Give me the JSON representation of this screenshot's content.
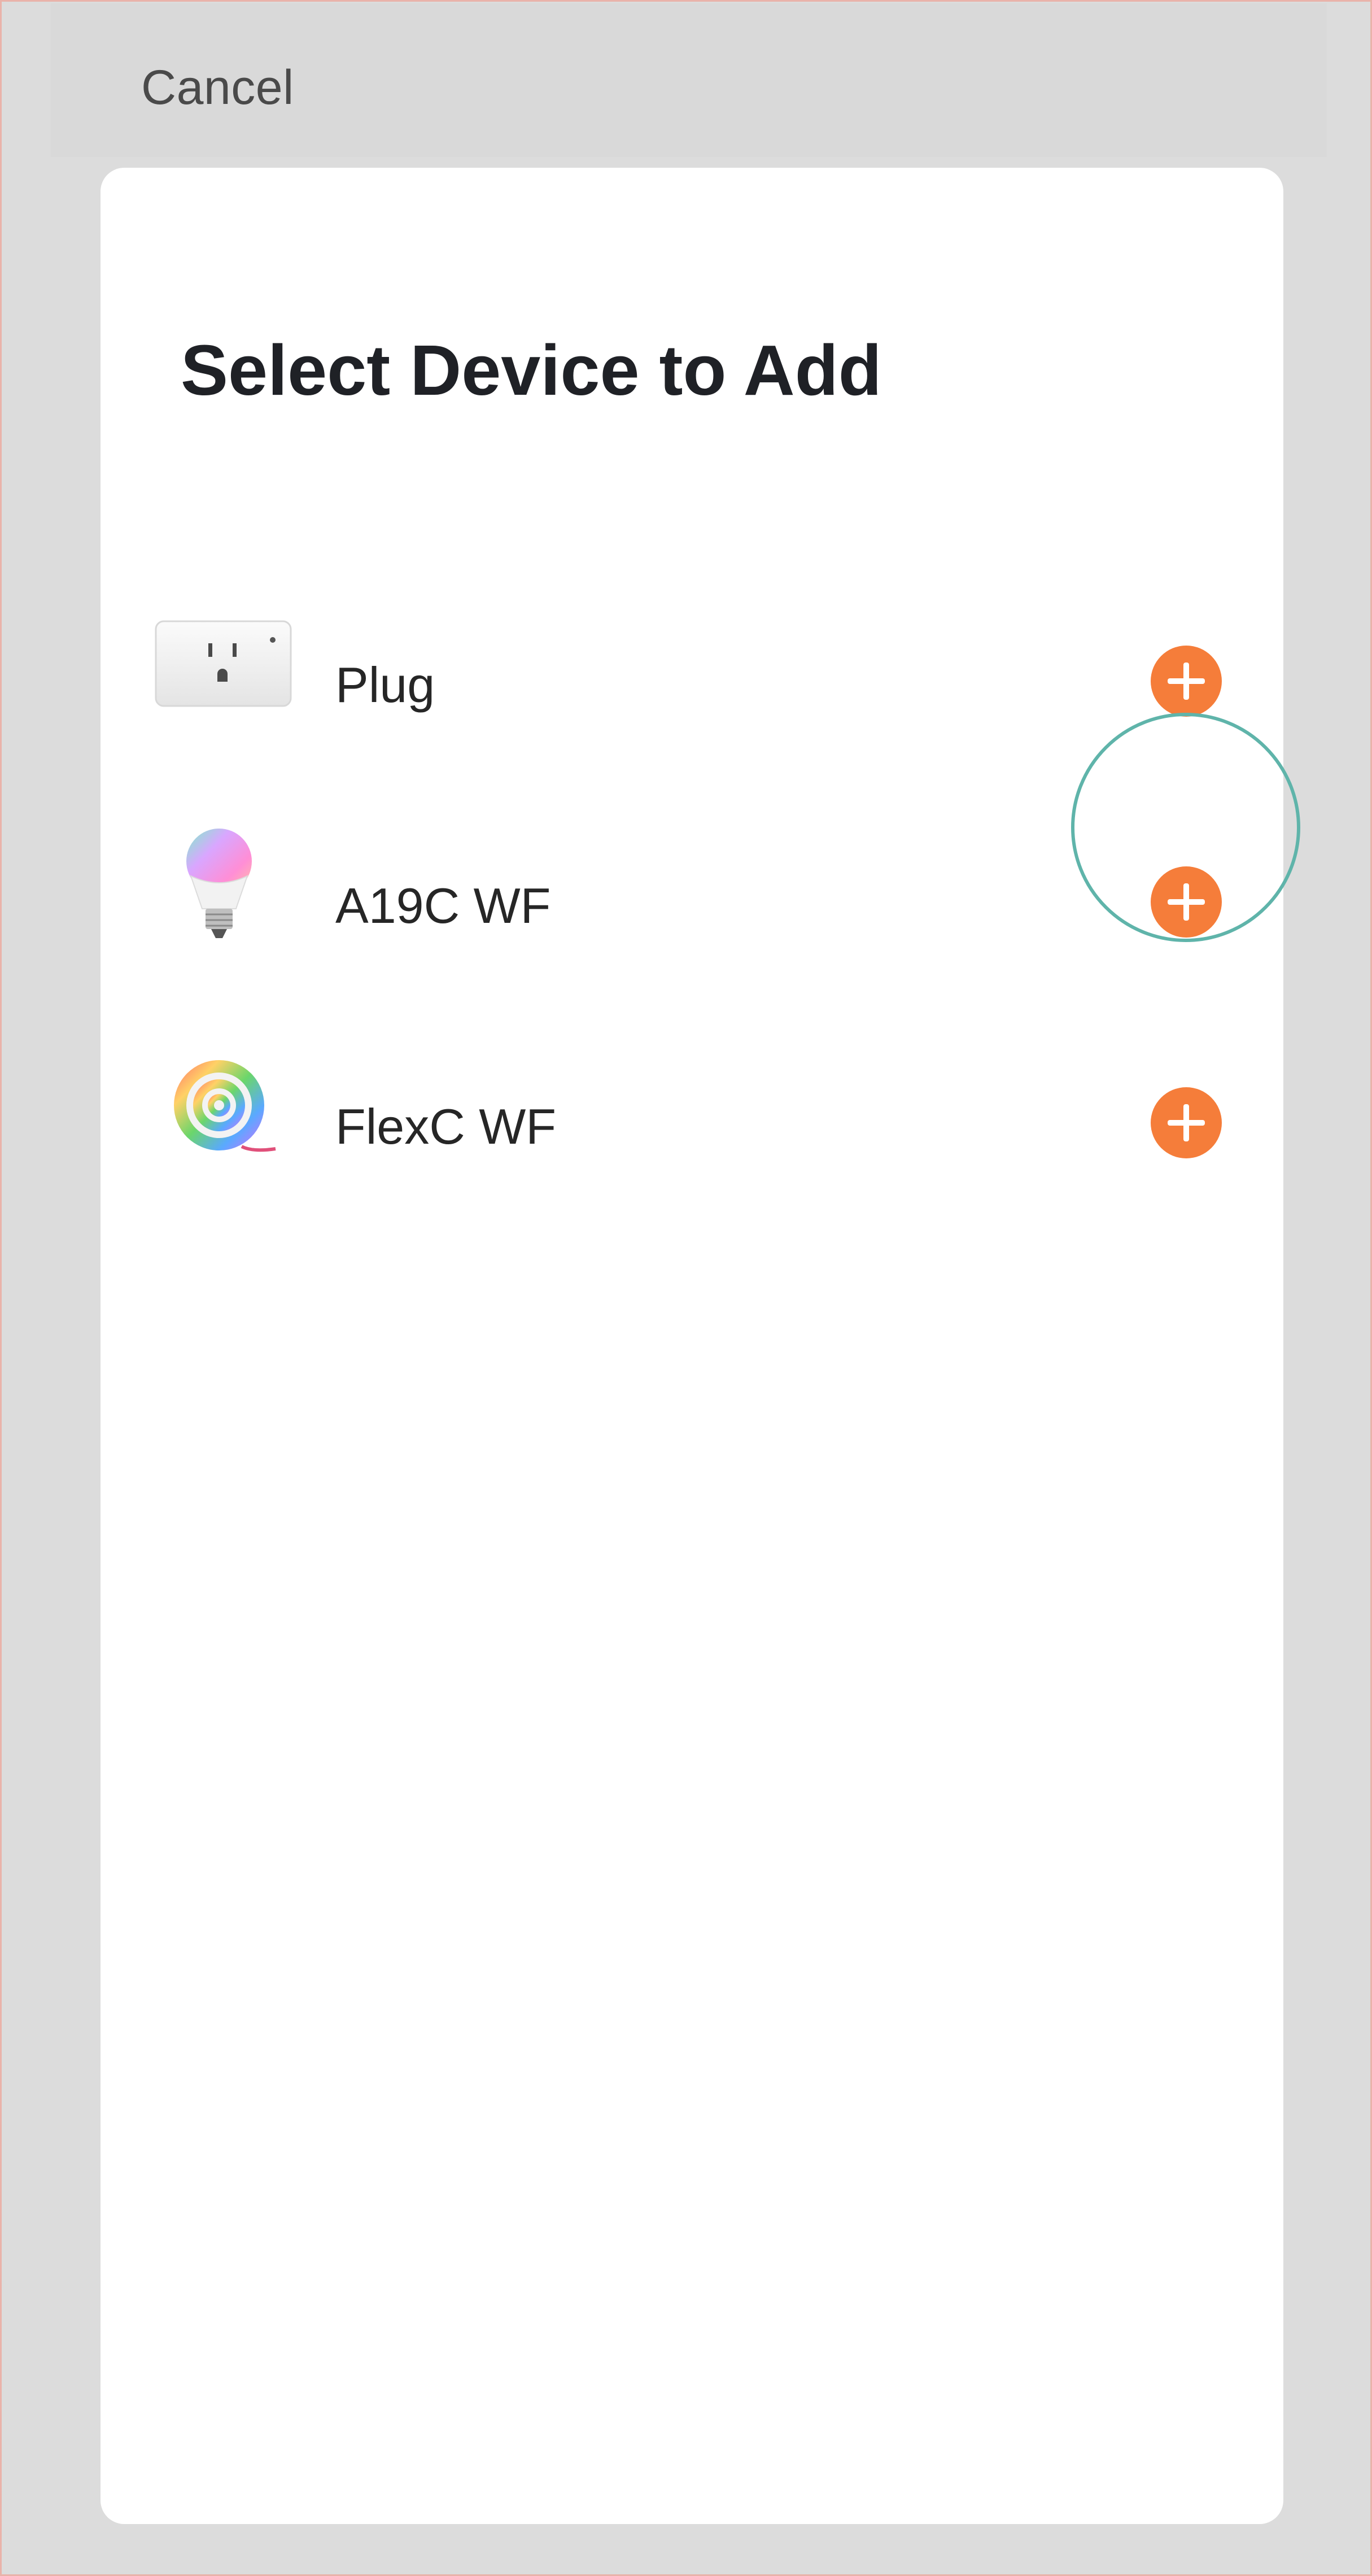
{
  "header": {
    "cancel_label": "Cancel"
  },
  "dialog": {
    "title": "Select Device to Add",
    "devices": [
      {
        "label": "Plug",
        "icon": "smart-plug-icon",
        "action_icon": "plus-icon"
      },
      {
        "label": "A19C WF",
        "icon": "color-bulb-icon",
        "action_icon": "plus-icon"
      },
      {
        "label": "FlexC WF",
        "icon": "light-strip-icon",
        "action_icon": "plus-icon"
      }
    ]
  },
  "colors": {
    "accent": "#f57d3a",
    "highlight_ring": "#5fb4aa",
    "overlay": "#dcdcdc",
    "sheet": "#ffffff"
  }
}
